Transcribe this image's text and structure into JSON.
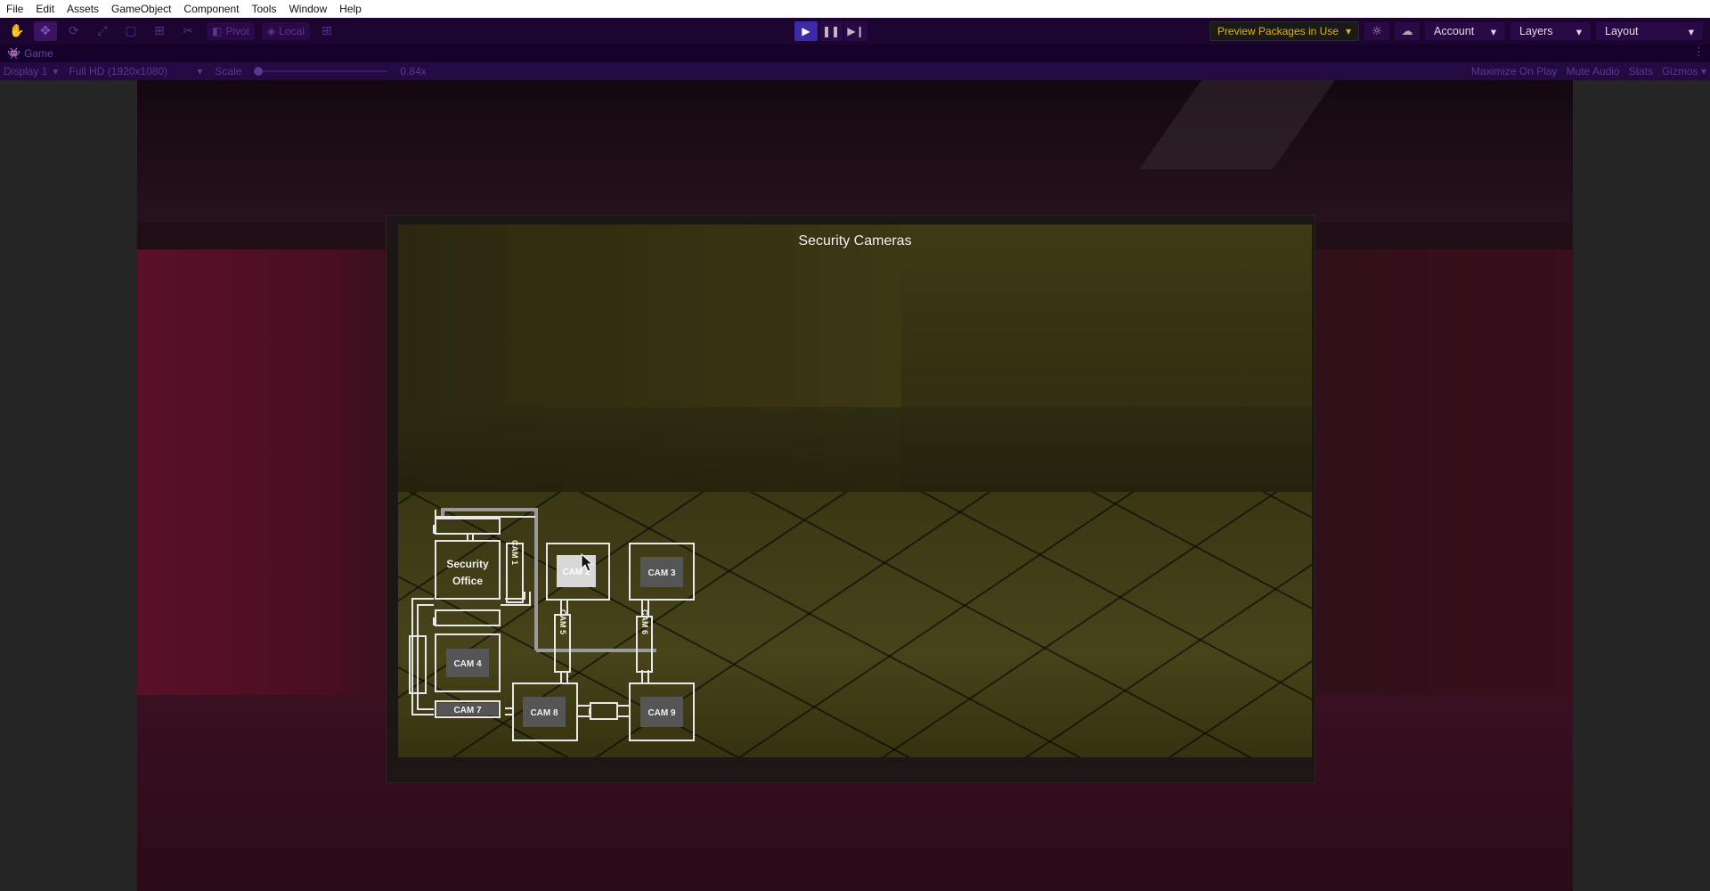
{
  "menubar": {
    "items": [
      "File",
      "Edit",
      "Assets",
      "GameObject",
      "Component",
      "Tools",
      "Window",
      "Help"
    ]
  },
  "toolbar": {
    "pivot_label": "Pivot",
    "local_label": "Local",
    "preview_packages": "Preview Packages in Use",
    "account": "Account",
    "layers": "Layers",
    "layout": "Layout",
    "accent_color": "#3d2aa8"
  },
  "tab": {
    "label": "Game"
  },
  "gamebar": {
    "display": "Display 1",
    "resolution": "Full HD (1920x1080)",
    "scale_label": "Scale",
    "scale_value": "0.84x",
    "maximize": "Maximize On Play",
    "mute": "Mute Audio",
    "stats": "Stats",
    "gizmos": "Gizmos"
  },
  "camera_ui": {
    "title": "Security Cameras",
    "office_label_1": "Security",
    "office_label_2": "Office",
    "cam1": "CAM 1",
    "cam2": "CAM 2",
    "cam3": "CAM 3",
    "cam4": "CAM 4",
    "cam5": "CAM 5",
    "cam6": "CAM 6",
    "cam7": "CAM 7",
    "cam8": "CAM 8",
    "cam9": "CAM 9",
    "selected_camera": "CAM 2"
  }
}
